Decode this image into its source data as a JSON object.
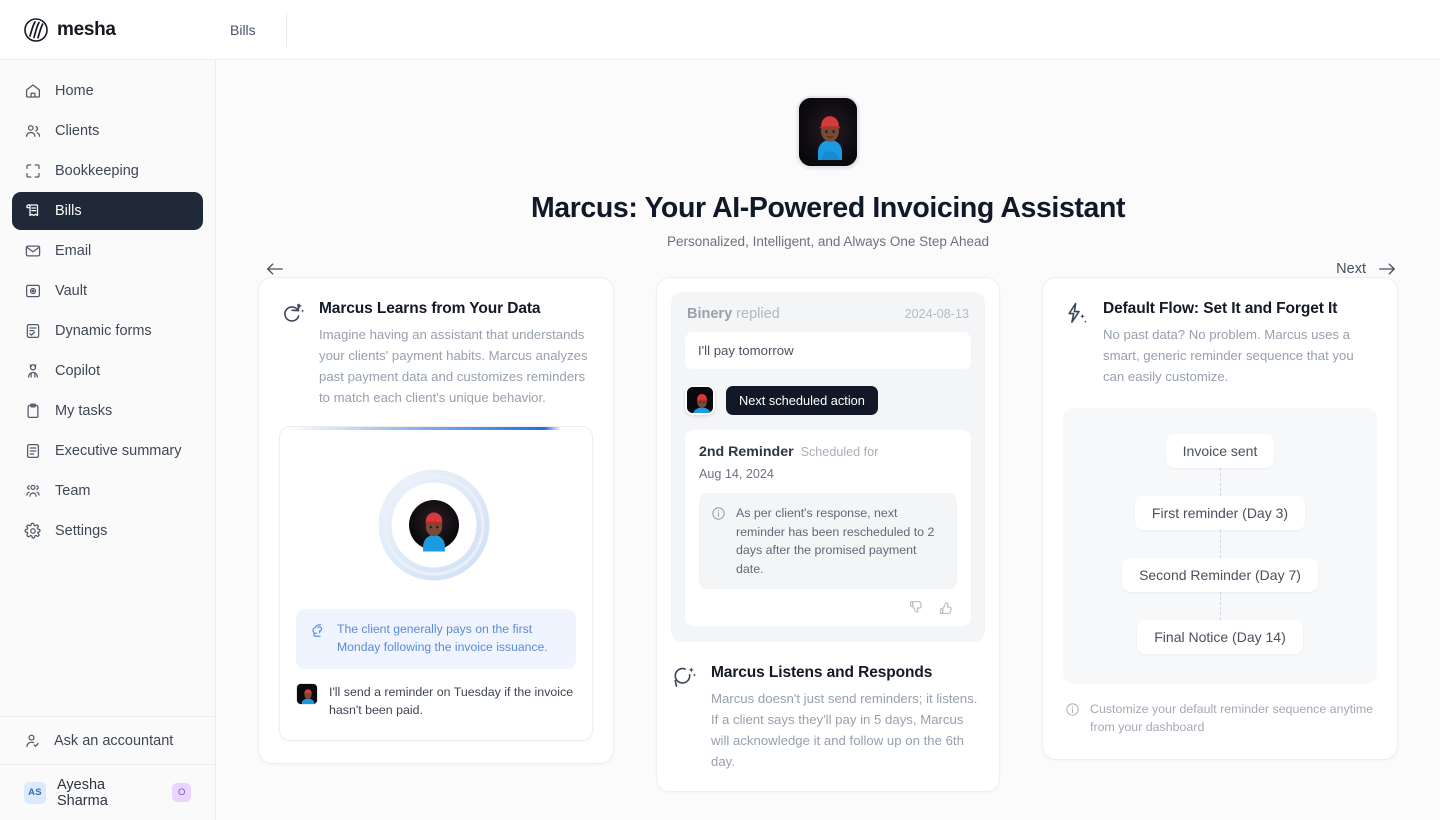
{
  "brand": {
    "name": "mesha",
    "logo_icon": "mesha-logo-icon"
  },
  "topnav": {
    "tabs": [
      {
        "label": "Bills"
      }
    ]
  },
  "sidebar": {
    "items": [
      {
        "label": "Home",
        "icon": "home-icon",
        "active": false
      },
      {
        "label": "Clients",
        "icon": "users-icon",
        "active": false
      },
      {
        "label": "Bookkeeping",
        "icon": "scan-corners-icon",
        "active": false
      },
      {
        "label": "Bills",
        "icon": "receipt-icon",
        "active": true
      },
      {
        "label": "Email",
        "icon": "envelope-icon",
        "active": false
      },
      {
        "label": "Vault",
        "icon": "vault-icon",
        "active": false
      },
      {
        "label": "Dynamic forms",
        "icon": "form-check-icon",
        "active": false
      },
      {
        "label": "Copilot",
        "icon": "robot-icon",
        "active": false
      },
      {
        "label": "My tasks",
        "icon": "clipboard-icon",
        "active": false
      },
      {
        "label": "Executive summary",
        "icon": "document-lines-icon",
        "active": false
      },
      {
        "label": "Team",
        "icon": "team-icon",
        "active": false
      },
      {
        "label": "Settings",
        "icon": "gear-icon",
        "active": false
      }
    ],
    "ask": {
      "label": "Ask an accountant",
      "icon": "user-check-icon"
    },
    "user": {
      "initials": "AS",
      "name": "Ayesha Sharma",
      "badge": "O"
    }
  },
  "hero": {
    "avatar_icon": "marcus-avatar",
    "title": "Marcus: Your AI-Powered Invoicing Assistant",
    "subtitle": "Personalized, Intelligent, and Always One Step Ahead",
    "back_label": "",
    "back_icon": "arrow-left-icon",
    "next_label": "Next",
    "next_icon": "arrow-right-icon"
  },
  "cards": {
    "left": {
      "icon": "sparkle-refresh-icon",
      "title": "Marcus Learns from Your Data",
      "desc": "Imagine having an assistant that understands your clients' payment habits. Marcus analyzes past payment data and customizes reminders to match each client's unique behavior.",
      "demo": {
        "orb_icon": "ai-orb-graphic",
        "insight_icon": "brain-icon",
        "insight_text": "The client generally pays on the first Monday following the invoice issuance.",
        "reply_avatar_icon": "marcus-avatar",
        "reply_text": "I'll send a reminder on Tuesday if the invoice hasn't been paid."
      }
    },
    "middle": {
      "thread": {
        "sender": "Binery",
        "verb": "replied",
        "date": "2024-08-13",
        "message": "I'll pay tomorrow",
        "action_avatar_icon": "marcus-avatar",
        "action_chip": "Next scheduled action"
      },
      "reminder": {
        "title": "2nd Reminder",
        "scheduled_label": "Scheduled for",
        "date": "Aug 14, 2024",
        "note_icon": "info-icon",
        "note": "As per client's response, next reminder has been rescheduled to 2 days after the promised payment date.",
        "thumbs_down_icon": "thumbs-down-icon",
        "thumbs_up_icon": "thumbs-up-icon"
      },
      "feature": {
        "icon": "sparkle-chat-icon",
        "title": "Marcus Listens and Responds",
        "desc": "Marcus doesn't just send reminders; it listens. If a client says they'll pay in 5 days, Marcus will acknowledge it and follow up on the 6th day."
      }
    },
    "right": {
      "icon": "sparkle-bolt-icon",
      "title": "Default Flow: Set It and Forget It",
      "desc": "No past data? No problem. Marcus uses a smart, generic reminder sequence that you can easily customize.",
      "flow_steps": [
        {
          "label": "Invoice sent"
        },
        {
          "label": "First reminder (Day 3)"
        },
        {
          "label": "Second Reminder (Day 7)"
        },
        {
          "label": "Final Notice (Day 14)"
        }
      ],
      "footnote_icon": "info-icon",
      "footnote": "Customize your default reminder sequence anytime from your dashboard"
    }
  },
  "colors": {
    "accent_blue": "#1f6fe0",
    "sidebar_active": "#1f2937",
    "insight_bg": "#eff4fe",
    "insight_text": "#5c8bd6",
    "chip_bg": "#111827"
  }
}
